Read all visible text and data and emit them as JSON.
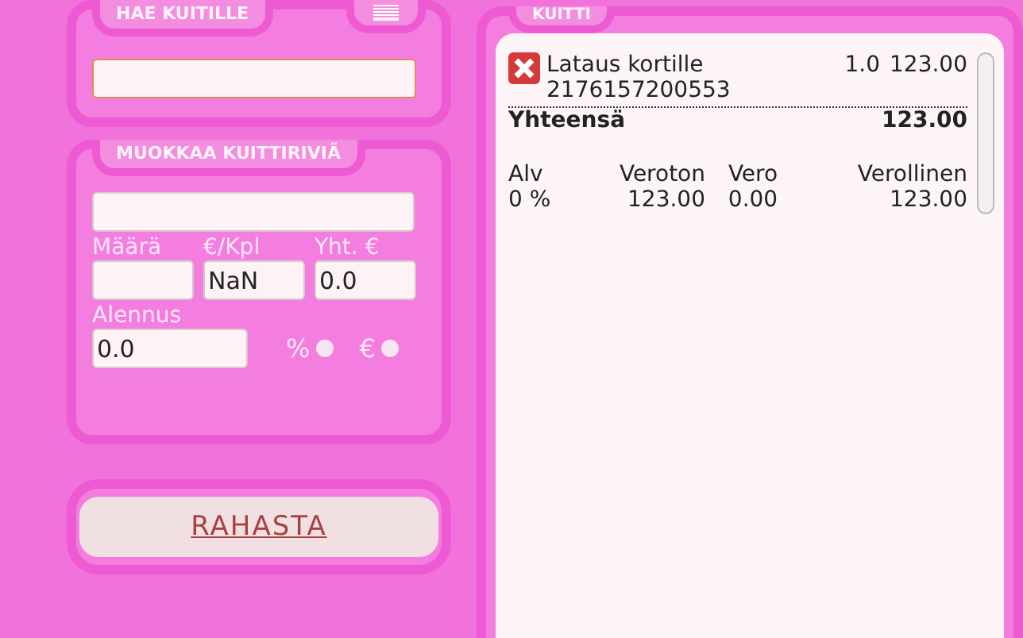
{
  "search_panel": {
    "title": "HAE KUITILLE"
  },
  "edit_panel": {
    "title": "MUOKKAA KUITTIRIVIÄ",
    "fields": [
      {
        "label": "Määrä"
      },
      {
        "label": "€/Kpl",
        "value": "NaN"
      },
      {
        "label": "Yht. €",
        "value": "0.0"
      }
    ],
    "discount_label": "Alennus",
    "discount_value": "0.0",
    "discount_modes": [
      {
        "label": "%",
        "selected": false
      },
      {
        "label": "€",
        "selected": false
      }
    ]
  },
  "checkout_button": "RAHASTA",
  "receipt": {
    "title": "KUITTI",
    "lines": [
      {
        "name": "Lataus kortille",
        "code": "2176157200553",
        "quantity": "1.0",
        "price": "123.00"
      }
    ],
    "total_label": "Yhteensä",
    "total": "123.00",
    "tax_columns": [
      "Alv",
      "Veroton",
      "Vero",
      "Verollinen"
    ],
    "tax_rows": [
      [
        "0 %",
        "123.00",
        "0.00",
        "123.00"
      ]
    ]
  }
}
